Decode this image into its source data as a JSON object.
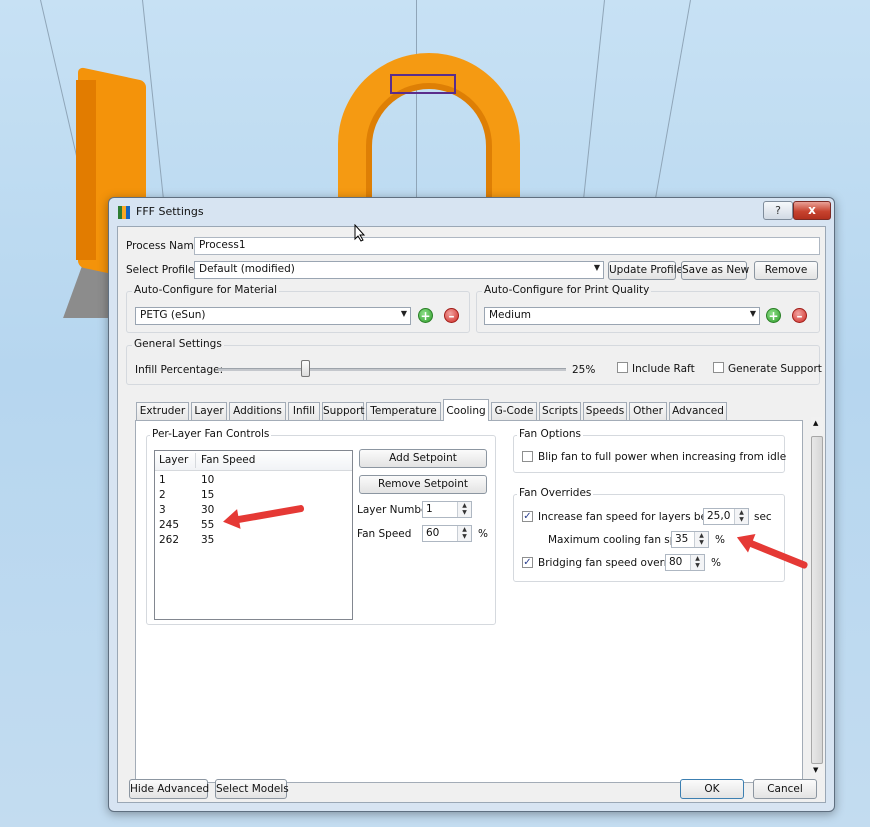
{
  "window": {
    "title": "FFF Settings",
    "help_glyph": "?",
    "close_glyph": "x"
  },
  "process": {
    "label": "Process Name:",
    "value": "Process1"
  },
  "profile": {
    "label": "Select Profile:",
    "value": "Default (modified)",
    "update_label": "Update Profile",
    "save_new_label": "Save as New",
    "remove_label": "Remove"
  },
  "material": {
    "group_title": "Auto-Configure for Material",
    "value": "PETG (eSun)"
  },
  "quality": {
    "group_title": "Auto-Configure for Print Quality",
    "value": "Medium"
  },
  "general": {
    "group_title": "General Settings",
    "infill_label": "Infill Percentage:",
    "infill_value": "25%",
    "infill_fraction": 0.25,
    "raft_label": "Include Raft",
    "raft_checked": false,
    "support_label": "Generate Support",
    "support_checked": false
  },
  "tabs": [
    "Extruder",
    "Layer",
    "Additions",
    "Infill",
    "Support",
    "Temperature",
    "Cooling",
    "G-Code",
    "Scripts",
    "Speeds",
    "Other",
    "Advanced"
  ],
  "active_tab": "Cooling",
  "per_layer": {
    "group_title": "Per-Layer Fan Controls",
    "col_layer": "Layer",
    "col_speed": "Fan Speed",
    "rows": [
      {
        "layer": "1",
        "speed": "10"
      },
      {
        "layer": "2",
        "speed": "15"
      },
      {
        "layer": "3",
        "speed": "30"
      },
      {
        "layer": "245",
        "speed": "55"
      },
      {
        "layer": "262",
        "speed": "35"
      }
    ],
    "add_label": "Add Setpoint",
    "remove_label": "Remove Setpoint",
    "layer_number_label": "Layer Number",
    "layer_number_value": "1",
    "fan_speed_label": "Fan Speed",
    "fan_speed_value": "60",
    "fan_speed_unit": "%"
  },
  "fan_options": {
    "group_title": "Fan Options",
    "blip_label": "Blip fan to full power when increasing from idle",
    "blip_checked": false
  },
  "fan_overrides": {
    "group_title": "Fan Overrides",
    "increase_label": "Increase fan speed for layers below",
    "increase_checked": true,
    "increase_value": "25,0",
    "increase_unit": "sec",
    "max_cooling_label": "Maximum cooling fan speed",
    "max_cooling_value": "35",
    "max_cooling_unit": "%",
    "bridging_label": "Bridging fan speed override",
    "bridging_checked": true,
    "bridging_value": "80",
    "bridging_unit": "%"
  },
  "footer": {
    "hide_advanced_label": "Hide Advanced",
    "select_models_label": "Select Models",
    "ok_label": "OK",
    "cancel_label": "Cancel"
  },
  "colors": {
    "object_orange": "#f59a12",
    "annotation_red": "#e53935",
    "selection_purple": "#5a2d8c"
  }
}
